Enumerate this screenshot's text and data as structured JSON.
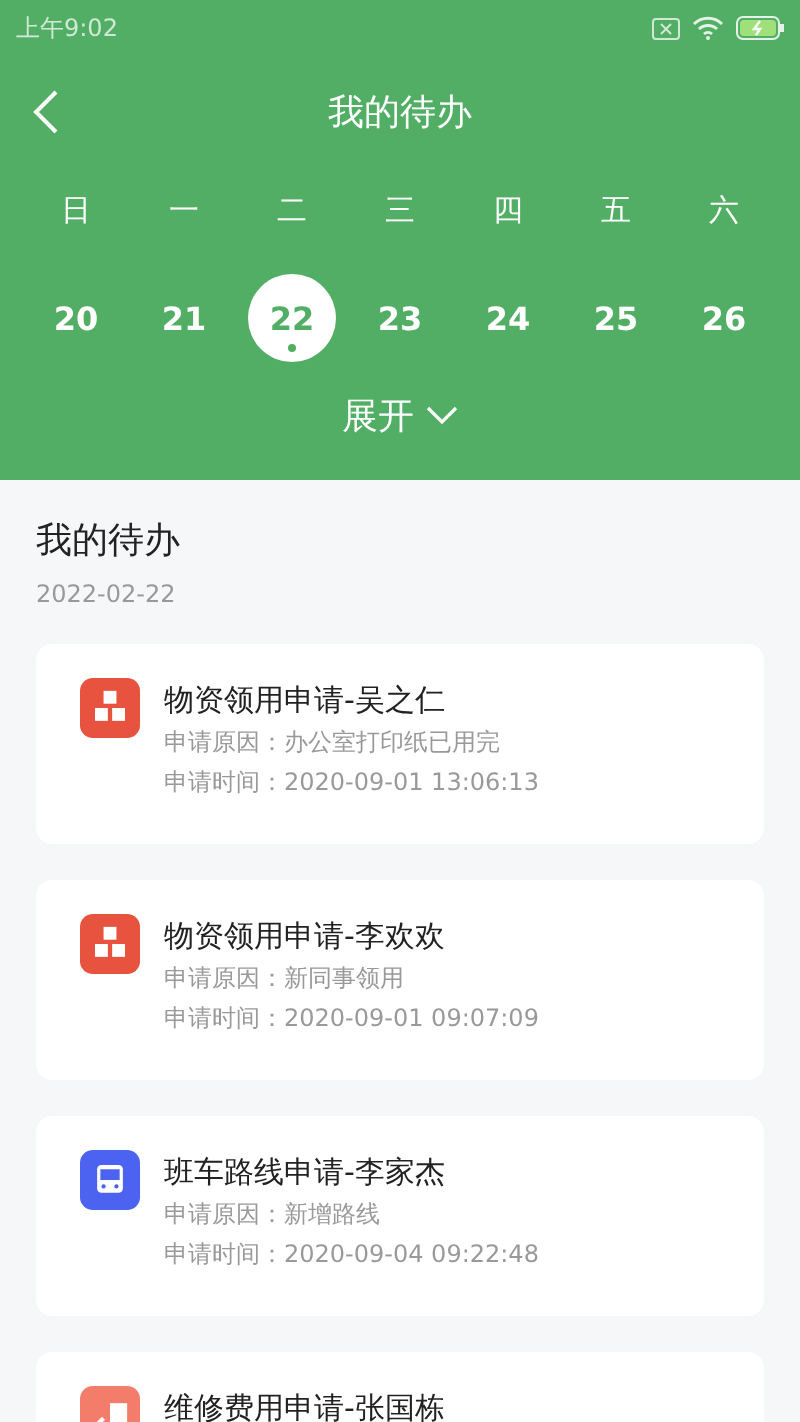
{
  "status_bar": {
    "time": "上午9:02"
  },
  "header": {
    "title": "我的待办"
  },
  "calendar": {
    "weekdays": [
      "日",
      "一",
      "二",
      "三",
      "四",
      "五",
      "六"
    ],
    "days": [
      {
        "label": "20",
        "selected": false,
        "marked": false
      },
      {
        "label": "21",
        "selected": false,
        "marked": false
      },
      {
        "label": "22",
        "selected": true,
        "marked": true
      },
      {
        "label": "23",
        "selected": false,
        "marked": false
      },
      {
        "label": "24",
        "selected": false,
        "marked": false
      },
      {
        "label": "25",
        "selected": false,
        "marked": false
      },
      {
        "label": "26",
        "selected": false,
        "marked": false
      }
    ],
    "expand_label": "展开"
  },
  "section": {
    "title": "我的待办",
    "date": "2022-02-22"
  },
  "tasks": [
    {
      "kind": "supplies",
      "title": "物资领用申请-吴之仁",
      "reason": "申请原因：办公室打印纸已用完",
      "time": "申请时间：2020-09-01 13:06:13"
    },
    {
      "kind": "supplies",
      "title": "物资领用申请-李欢欢",
      "reason": "申请原因：新同事领用",
      "time": "申请时间：2020-09-01 09:07:09"
    },
    {
      "kind": "bus",
      "title": "班车路线申请-李家杰",
      "reason": "申请原因：新增路线",
      "time": "申请时间：2020-09-04 09:22:48"
    },
    {
      "kind": "repair",
      "title": "维修费用申请-张国栋"
    }
  ]
}
